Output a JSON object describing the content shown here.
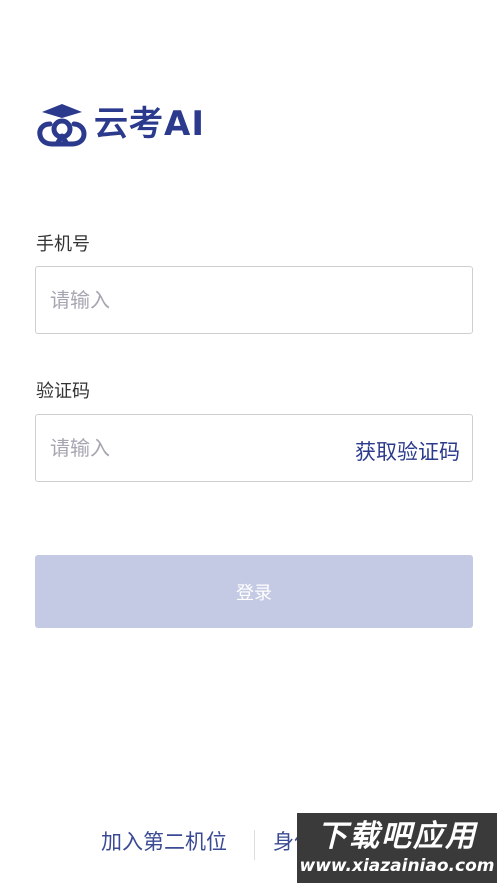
{
  "brand": {
    "name": "云考AI",
    "color": "#2b3a8c"
  },
  "phone": {
    "label": "手机号",
    "placeholder": "请输入"
  },
  "code": {
    "label": "验证码",
    "placeholder": "请输入",
    "get_code_label": "获取验证码"
  },
  "login": {
    "label": "登录",
    "color": "#c4c9e4"
  },
  "footer": {
    "join_label": "加入第二机位",
    "second_label": "身份"
  },
  "watermark": {
    "main": "下载吧应用",
    "sub": "www.xiazainiao.com"
  }
}
